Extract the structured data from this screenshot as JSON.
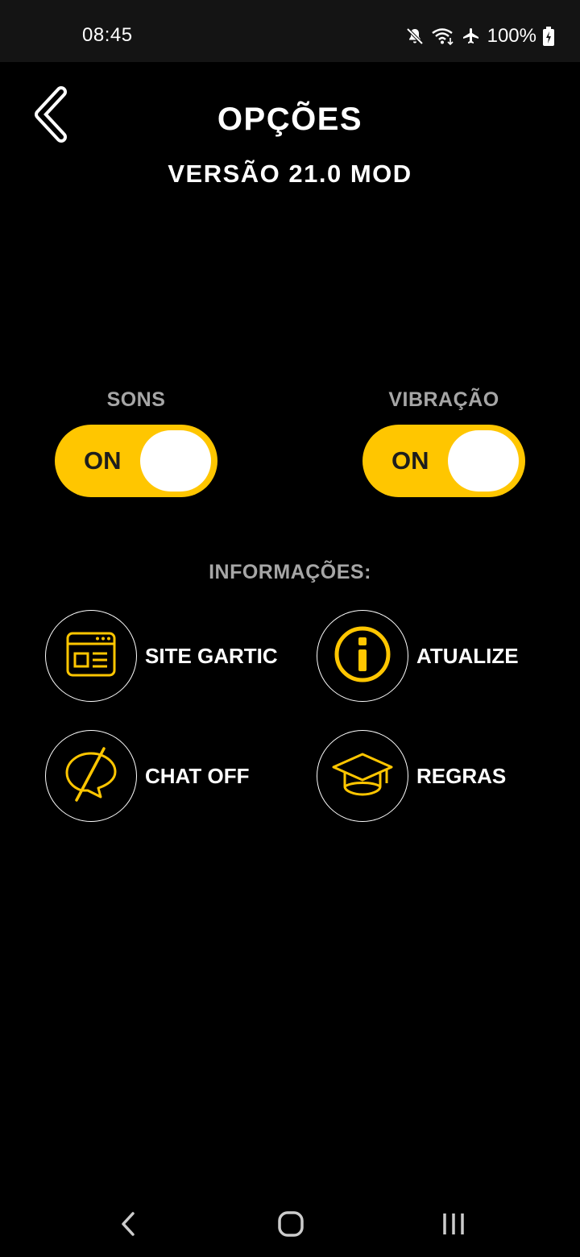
{
  "status_bar": {
    "time": "08:45",
    "battery": "100%",
    "icons": [
      "mute-icon",
      "wifi-icon",
      "airplane-icon",
      "battery-charging-icon"
    ]
  },
  "header": {
    "back_icon": "chevron-left-icon",
    "title": "OPÇÕES",
    "version": "VERSÃO 21.0 MOD"
  },
  "toggles": [
    {
      "label": "SONS",
      "state": "ON"
    },
    {
      "label": "VIBRAÇÃO",
      "state": "ON"
    }
  ],
  "info": {
    "heading": "INFORMAÇÕES:",
    "items": [
      {
        "label": "SITE GARTIC",
        "icon": "website-icon"
      },
      {
        "label": "ATUALIZE",
        "icon": "info-icon"
      },
      {
        "label": "CHAT OFF",
        "icon": "chat-off-icon"
      },
      {
        "label": "REGRAS",
        "icon": "graduation-cap-icon"
      }
    ]
  },
  "nav_bar": {
    "icons": [
      "back-icon",
      "home-icon",
      "recents-icon"
    ]
  },
  "colors": {
    "accent": "#ffc600",
    "background": "#000000",
    "label_gray": "#a6a6a6"
  }
}
